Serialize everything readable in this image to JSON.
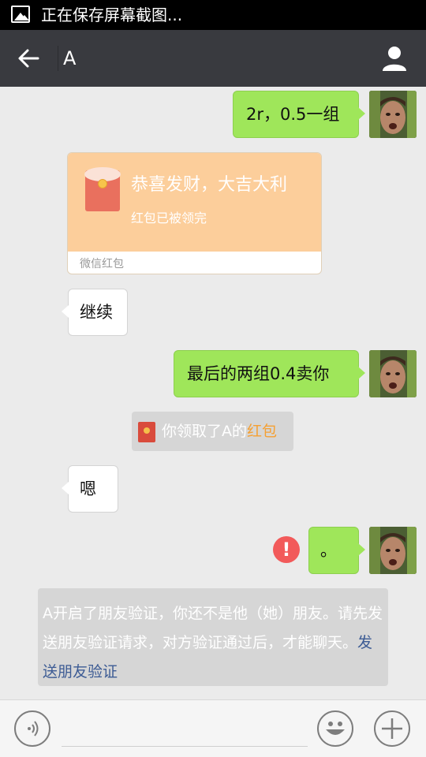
{
  "status_bar": {
    "text": "正在保存屏幕截图..."
  },
  "nav": {
    "title": "A"
  },
  "messages": {
    "m1": "2r，0.5一组",
    "m4": "继续",
    "m5": "最后的两组0.4卖你",
    "m7": "嗯",
    "m8": "。"
  },
  "red_packet": {
    "title": "恭喜发财，大吉大利",
    "status": "红包已被领完",
    "footer": "微信红包"
  },
  "system": {
    "received_prefix": "你领取了",
    "received_name": "A",
    "received_mid": "的",
    "received_link": "红包",
    "verify_name": "A",
    "verify_text": "开启了朋友验证，你还不是他（她）朋友。请先发送朋友验证请求，对方验证通过后，才能聊天。",
    "verify_link": "发送朋友验证"
  },
  "error_mark": "!",
  "colors": {
    "nav_bg": "#393a3f",
    "sent_bubble": "#9fe65a",
    "received_bubble": "#ffffff",
    "red_packet": "#fcce9b",
    "link_orange": "#f5a033",
    "link_blue": "#3c5b94",
    "error_red": "#f25a5a"
  }
}
